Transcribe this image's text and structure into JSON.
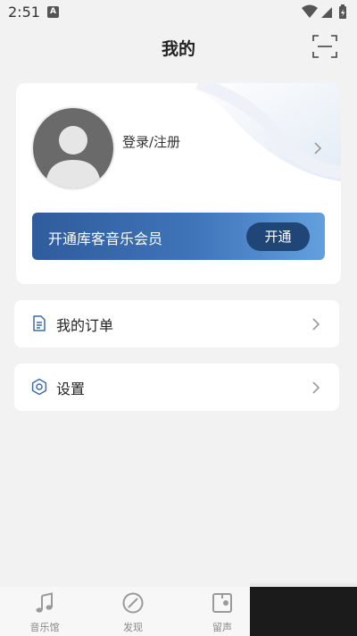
{
  "status_bar": {
    "time": "2:51",
    "notification_badge": "A",
    "icons": [
      "wifi-icon",
      "signal-icon",
      "battery-icon"
    ]
  },
  "header": {
    "title": "我的",
    "action_icon": "scan-icon"
  },
  "profile": {
    "login_label": "登录/注册",
    "avatar_icon": "default-avatar-icon",
    "vip": {
      "label": "开通库客音乐会员",
      "button": "开通"
    }
  },
  "menu": [
    {
      "label": "我的订单",
      "icon": "document-icon"
    },
    {
      "label": "设置",
      "icon": "settings-icon"
    }
  ],
  "bottom_nav": [
    {
      "label": "音乐馆",
      "icon": "music-note-icon"
    },
    {
      "label": "发现",
      "icon": "compass-icon"
    },
    {
      "label": "留声",
      "icon": "vinyl-box-icon"
    }
  ],
  "colors": {
    "background": "#f2f2f2",
    "vip_gradient_start": "#2f5c9c",
    "vip_gradient_end": "#63a0df",
    "vip_button": "#1f4677",
    "icon_blue": "#3d6cad"
  }
}
